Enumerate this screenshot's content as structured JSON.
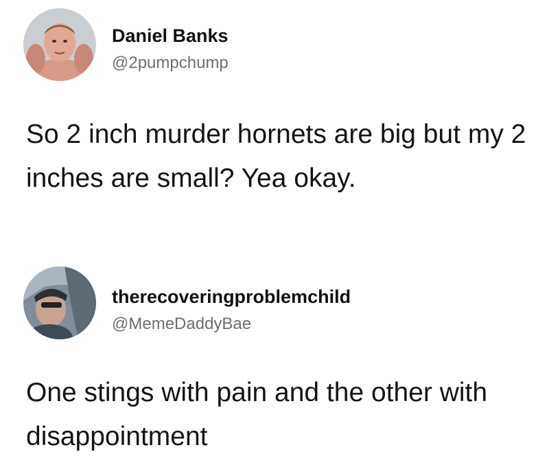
{
  "tweets": [
    {
      "display_name": "Daniel Banks",
      "handle": "@2pumpchump",
      "avatar_icon": "profile-photo-icon",
      "text": "So 2 inch murder hornets are big but my 2 inches are small? Yea okay."
    },
    {
      "display_name": "therecoveringproblemchild",
      "handle": "@MemeDaddyBae",
      "avatar_icon": "profile-photo-icon",
      "text": "One stings with pain and the other with disappointment"
    }
  ],
  "colors": {
    "background": "#ffffff",
    "name_text": "#111111",
    "handle_text": "#6b6f73",
    "body_text": "#141414"
  }
}
